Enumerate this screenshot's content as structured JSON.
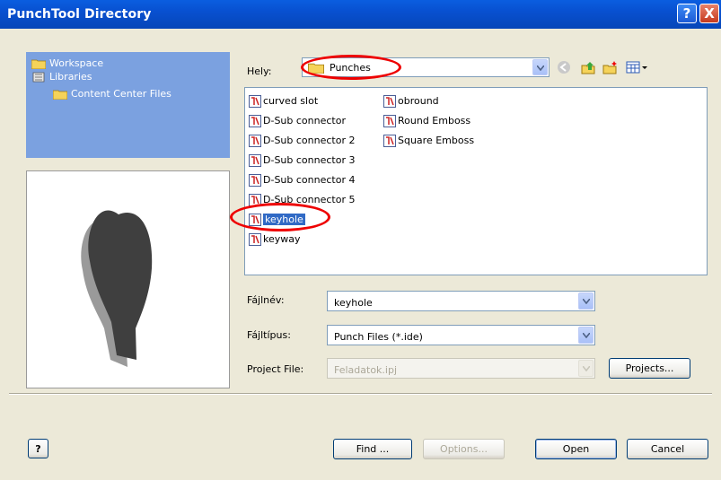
{
  "window": {
    "title": "PunchTool Directory",
    "help_glyph": "?",
    "close_glyph": "X"
  },
  "tree": {
    "items": [
      {
        "label": "Workspace",
        "icon": "folder-icon"
      },
      {
        "label": "Libraries",
        "icon": "libraries-icon"
      },
      {
        "label": "Content Center Files",
        "icon": "folder-icon"
      }
    ]
  },
  "look_in": {
    "label": "Hely:",
    "value": "Punches"
  },
  "files": {
    "col1": [
      "curved slot",
      "D-Sub connector",
      "D-Sub connector 2",
      "D-Sub connector 3",
      "D-Sub connector 4",
      "D-Sub connector 5",
      "keyhole",
      "keyway"
    ],
    "col2": [
      "obround",
      "Round Emboss",
      "Square Emboss"
    ],
    "selected": "keyhole"
  },
  "filename": {
    "label": "Fájlnév:",
    "value": "keyhole"
  },
  "filetype": {
    "label": "Fájltípus:",
    "value": "Punch Files (*.ide)"
  },
  "project": {
    "label": "Project File:",
    "value": "Feladatok.ipj",
    "button": "Projects..."
  },
  "buttons": {
    "find": "Find ...",
    "options": "Options...",
    "open": "Open",
    "cancel": "Cancel",
    "help_glyph": "?"
  },
  "colors": {
    "title_bar": "#0850d0",
    "tree_panel": "#7ba1e0",
    "selection": "#316ac5",
    "highlight_circle": "#e00000"
  }
}
